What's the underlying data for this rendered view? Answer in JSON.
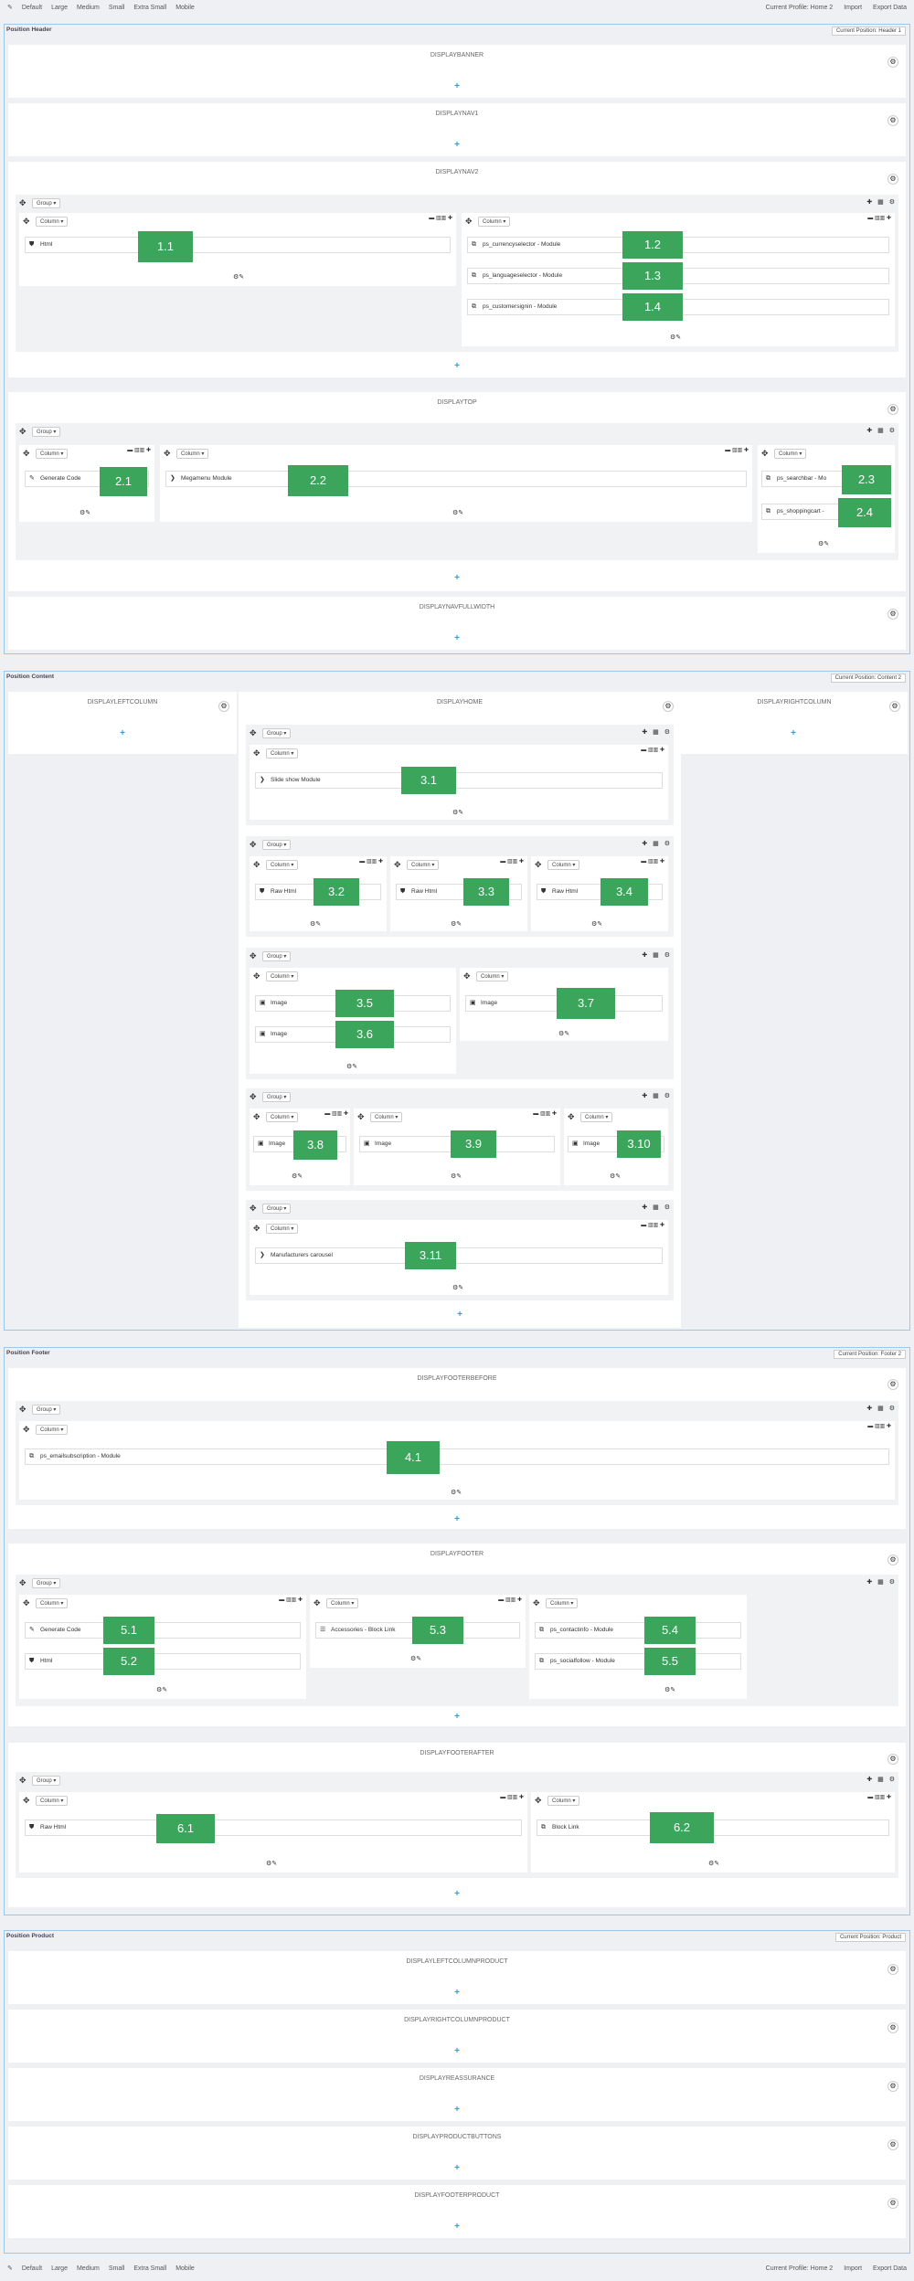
{
  "toolbar": {
    "icon": "pencil-icon",
    "sizes": [
      "Default",
      "Large",
      "Medium",
      "Small",
      "Extra Small",
      "Mobile"
    ],
    "profile": "Current Profile: Home 2",
    "import": "Import",
    "export": "Export Data"
  },
  "header": {
    "title": "Position Header",
    "selector": "Current Position: Header 1",
    "hooks": {
      "banner": "DISPLAYBANNER",
      "nav1": "DISPLAYNAV1",
      "nav2": "DISPLAYNAV2",
      "top": "DISPLAYTOP",
      "navfull": "DISPLAYNAVFULLWIDTH"
    }
  },
  "content": {
    "title": "Position Content",
    "selector": "Current Position: Content 2",
    "hooks": {
      "left": "DISPLAYLEFTCOLUMN",
      "home": "DISPLAYHOME",
      "right": "DISPLAYRIGHTCOLUMN"
    }
  },
  "footer": {
    "title": "Position Footer",
    "selector": "Current Position: Footer 2",
    "hooks": {
      "before": "DISPLAYFOOTERBEFORE",
      "footer": "DISPLAYFOOTER",
      "after": "DISPLAYFOOTERAFTER"
    }
  },
  "product": {
    "title": "Position Product",
    "selector": "Current Position: Product",
    "hooks": {
      "leftp": "DISPLAYLEFTCOLUMNPRODUCT",
      "rightp": "DISPLAYRIGHTCOLUMNPRODUCT",
      "reassurance": "DISPLAYREASSURANCE",
      "buttons": "DISPLAYPRODUCTBUTTONS",
      "footerp": "DISPLAYFOOTERPRODUCT"
    }
  },
  "labels": {
    "group": "Group ▾",
    "column": "Column ▾",
    "plus": "+",
    "gear": "⚙",
    "edit": "⚙✎",
    "move": "✥",
    "gicons": "✚ ▦ ⚙",
    "colicons": "▬ ▥▥ ✚"
  },
  "modules": {
    "m11": {
      "name": "Html",
      "badge": "1.1"
    },
    "m12": {
      "name": "ps_currencyselector - Module",
      "badge": "1.2"
    },
    "m13": {
      "name": "ps_languageselector - Module",
      "badge": "1.3"
    },
    "m14": {
      "name": "ps_customersignin - Module",
      "badge": "1.4"
    },
    "m21": {
      "name": "Generate Code",
      "badge": "2.1"
    },
    "m22": {
      "name": "Megamenu Module",
      "badge": "2.2"
    },
    "m23": {
      "name": "ps_searchbar - Mo",
      "badge": "2.3"
    },
    "m24": {
      "name": "ps_shoppingcart -",
      "badge": "2.4"
    },
    "m31": {
      "name": "Slide show Module",
      "badge": "3.1"
    },
    "m32": {
      "name": "Raw Html",
      "badge": "3.2"
    },
    "m33": {
      "name": "Raw Html",
      "badge": "3.3"
    },
    "m34": {
      "name": "Raw Html",
      "badge": "3.4"
    },
    "m35": {
      "name": "Image",
      "badge": "3.5"
    },
    "m36": {
      "name": "Image",
      "badge": "3.6"
    },
    "m37": {
      "name": "Image",
      "badge": "3.7"
    },
    "m38": {
      "name": "Image",
      "badge": "3.8"
    },
    "m39": {
      "name": "Image",
      "badge": "3.9"
    },
    "m310": {
      "name": "Image",
      "badge": "3.10"
    },
    "m311": {
      "name": "Manufacturers carousel",
      "badge": "3.11"
    },
    "m41": {
      "name": "ps_emailsubscription - Module",
      "badge": "4.1"
    },
    "m51": {
      "name": "Generate Code",
      "badge": "5.1"
    },
    "m52": {
      "name": "Html",
      "badge": "5.2"
    },
    "m53": {
      "name": "Accessories - Block Link",
      "badge": "5.3"
    },
    "m54": {
      "name": "ps_contactinfo - Module",
      "badge": "5.4"
    },
    "m55": {
      "name": "ps_socialfollow - Module",
      "badge": "5.5"
    },
    "m61": {
      "name": "Raw Html",
      "badge": "6.1"
    },
    "m62": {
      "name": "Block Link",
      "badge": "6.2"
    }
  }
}
